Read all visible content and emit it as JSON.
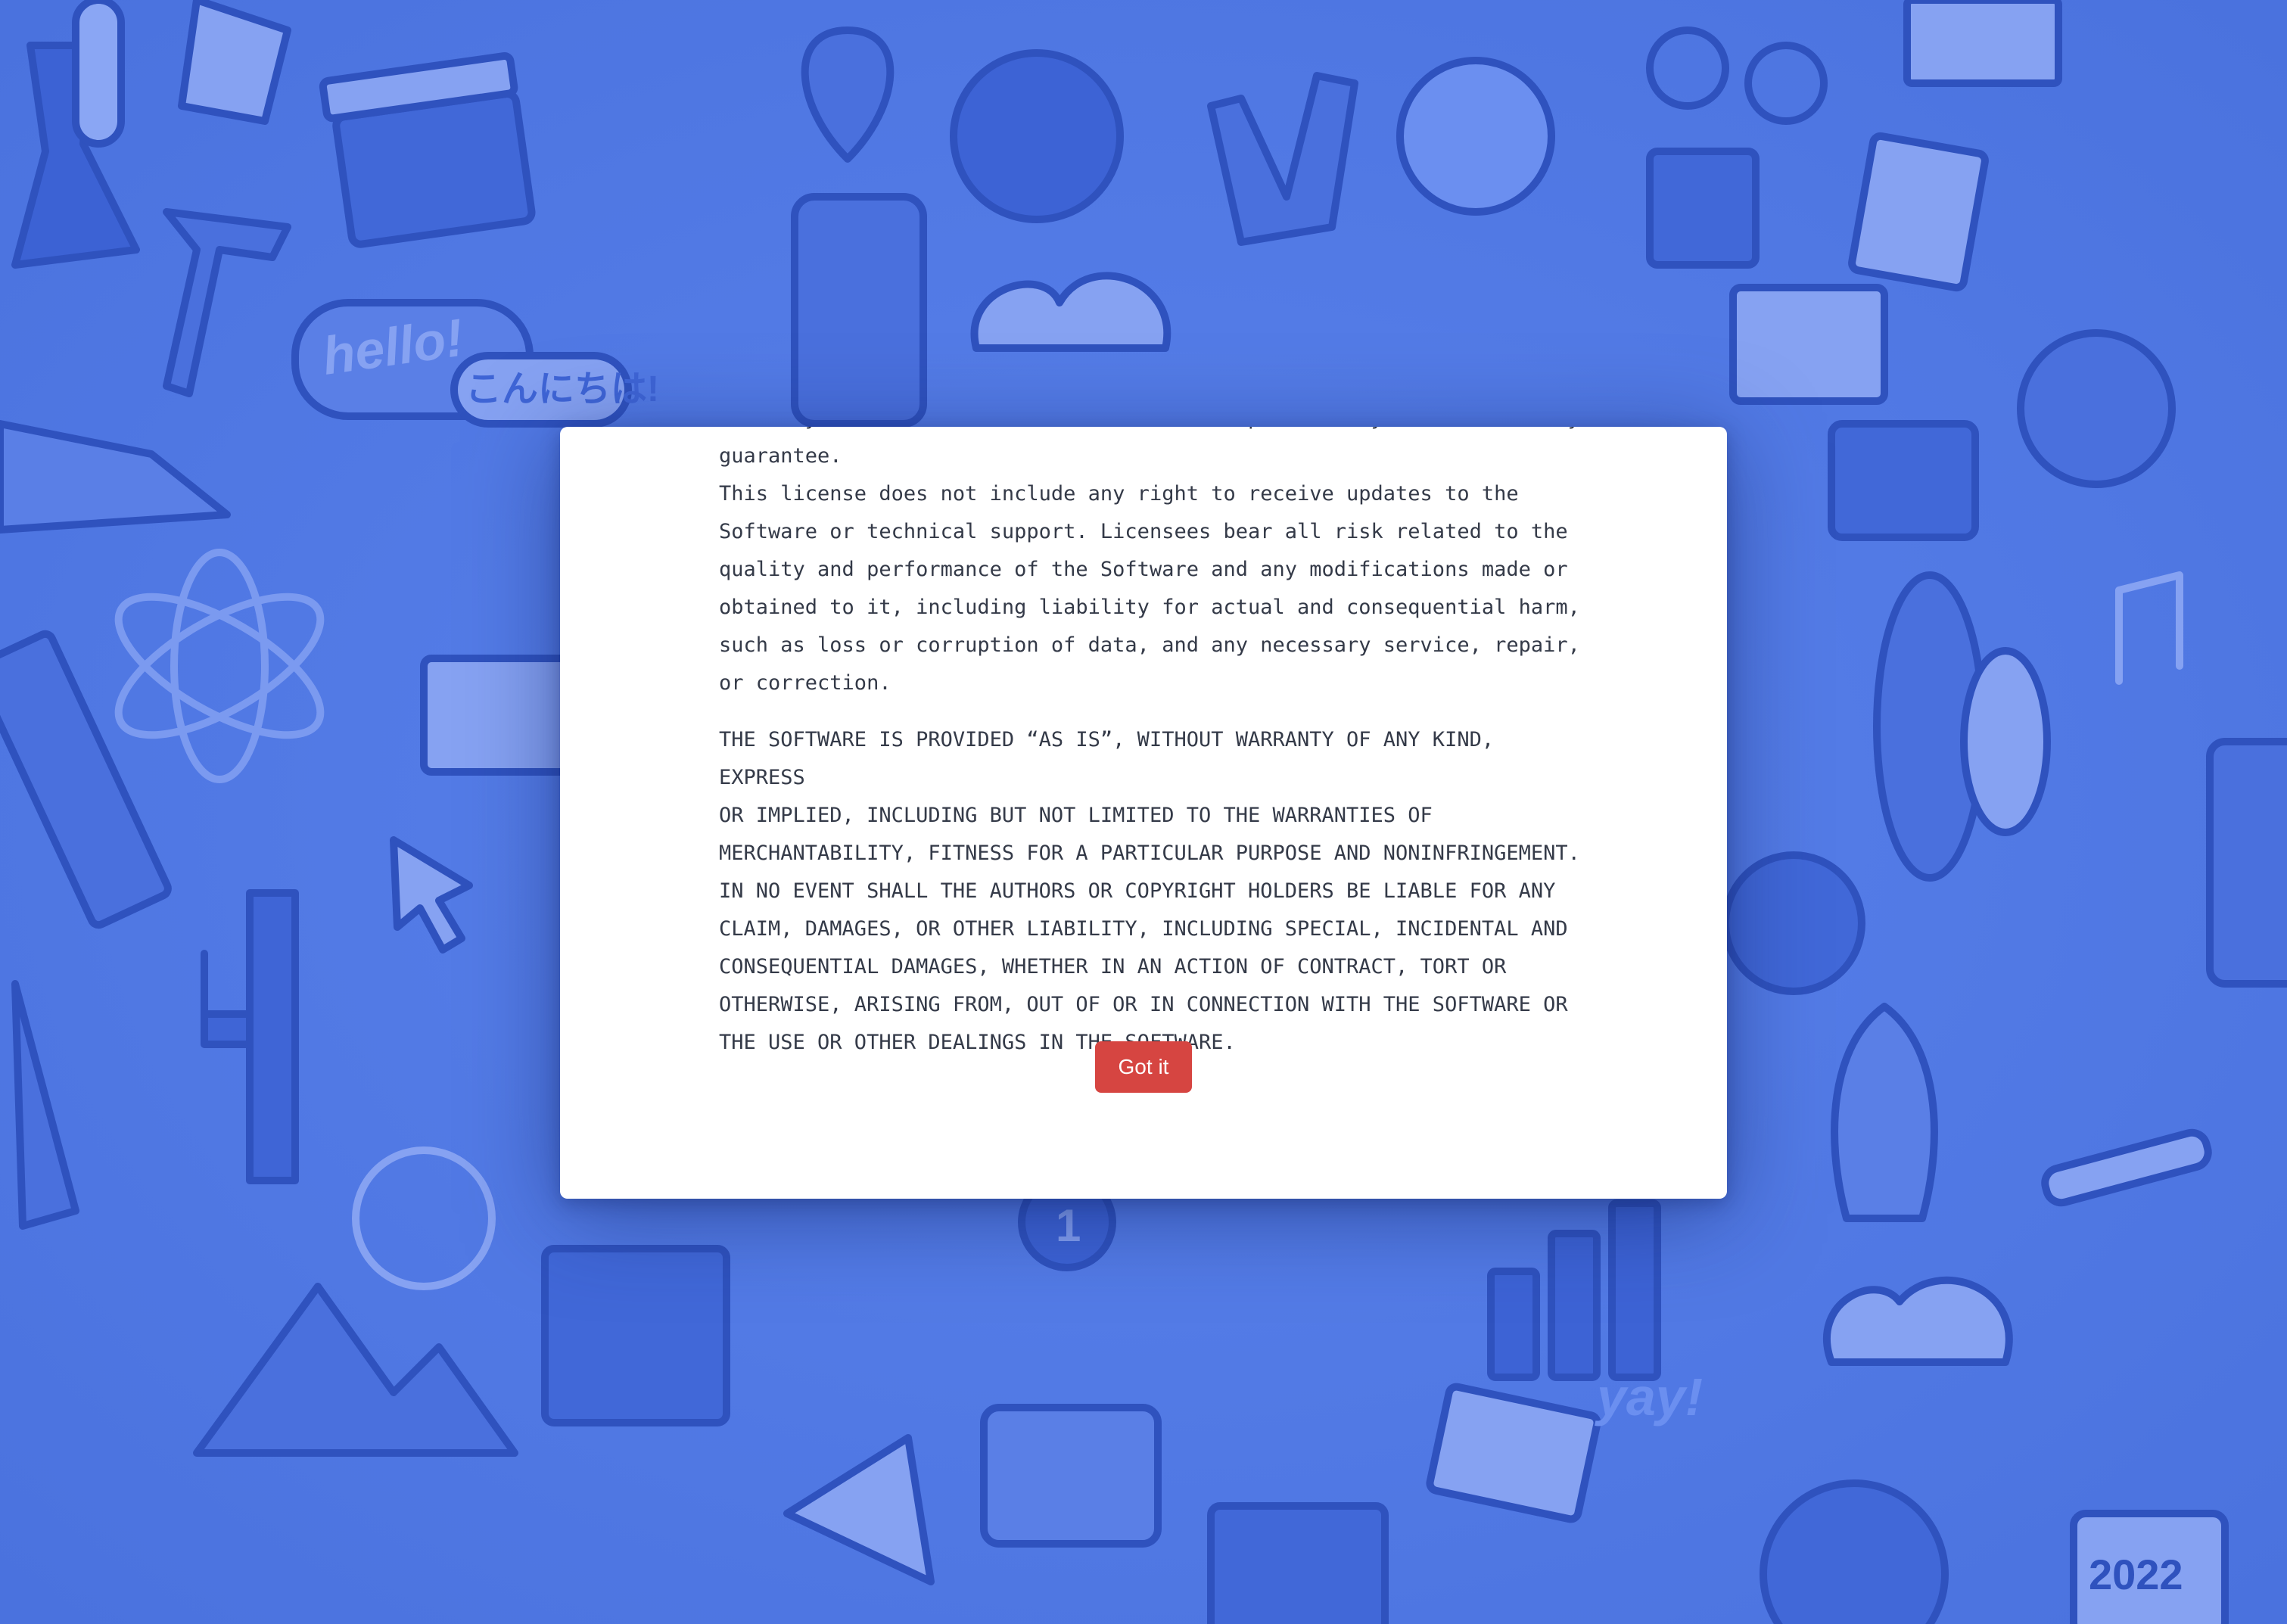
{
  "background": {
    "color": "#4f78e4",
    "doodle_texts": [
      "hello!",
      "こんにちは!",
      "yay!",
      "2022",
      "1"
    ]
  },
  "dialog": {
    "paragraphs": [
      "is fully at the Licensees' own risk and responsibility and without any guarantee.\nThis license does not include any right to receive updates to the\nSoftware or technical support. Licensees bear all risk related to the\nquality and performance of the Software and any modifications made or\nobtained to it, including liability for actual and consequential harm,\nsuch as loss or corruption of data, and any necessary service, repair,\nor correction.",
      "THE SOFTWARE IS PROVIDED “AS IS”, WITHOUT WARRANTY OF ANY KIND, EXPRESS\nOR IMPLIED, INCLUDING BUT NOT LIMITED TO THE WARRANTIES OF\nMERCHANTABILITY, FITNESS FOR A PARTICULAR PURPOSE AND NONINFRINGEMENT.\nIN NO EVENT SHALL THE AUTHORS OR COPYRIGHT HOLDERS BE LIABLE FOR ANY\nCLAIM, DAMAGES, OR OTHER LIABILITY, INCLUDING SPECIAL, INCIDENTAL AND\nCONSEQUENTIAL DAMAGES, WHETHER IN AN ACTION OF CONTRACT, TORT OR\nOTHERWISE, ARISING FROM, OUT OF OR IN CONNECTION WITH THE SOFTWARE OR\nTHE USE OR OTHER DEALINGS IN THE SOFTWARE."
    ],
    "button_label": "Got it",
    "button_color": "#d64541"
  }
}
